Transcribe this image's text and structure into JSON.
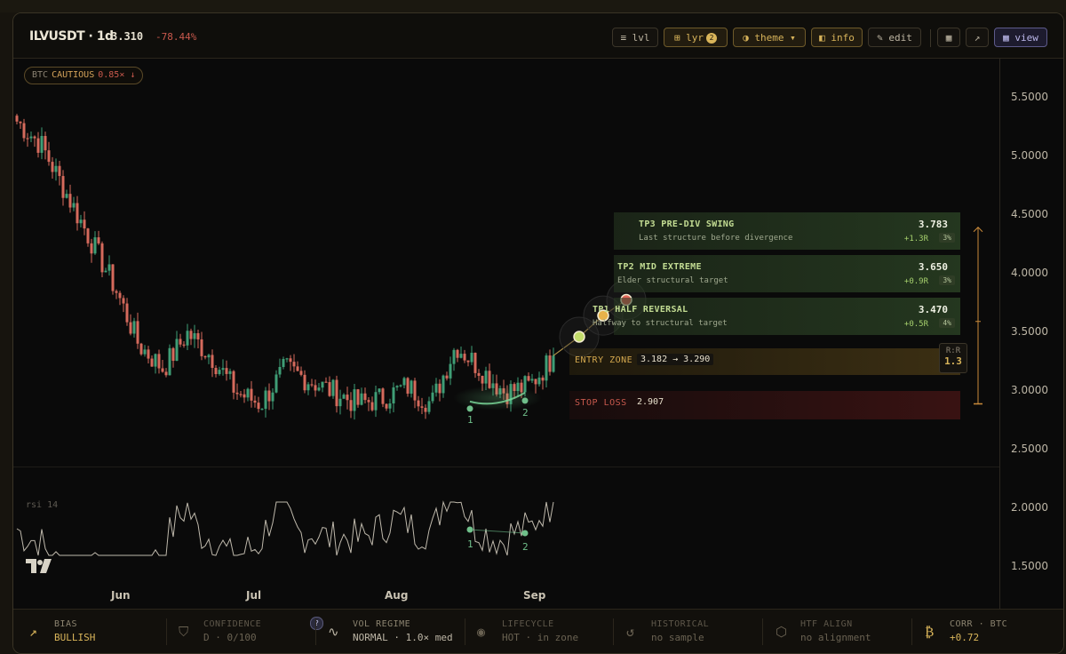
{
  "header": {
    "symbol": "ILVUSDT · 1d",
    "price": "3.310",
    "change": "-78.44%",
    "buttons": {
      "lvl": "≡ lvl",
      "lyr": "⊞ lyr",
      "lyr_badge": "2",
      "theme": "◑ theme ▾",
      "info": "◧ info",
      "edit": "✎ edit",
      "grid": "▦",
      "expand": "↗",
      "view": "▦ view"
    }
  },
  "btc_status": {
    "prefix": "BTC",
    "state": "CAUTIOUS",
    "multiplier": "0.85× ↓"
  },
  "y_axis": [
    "5.5000",
    "5.0000",
    "4.5000",
    "4.0000",
    "3.5000",
    "3.0000",
    "2.5000",
    "2.0000",
    "1.5000"
  ],
  "x_axis": [
    "Jun",
    "Jul",
    "Aug",
    "Sep"
  ],
  "rsi_label": "rsi 14",
  "pivot_labels": [
    "1",
    "2",
    "1",
    "2"
  ],
  "levels": {
    "entry": {
      "label": "ENTRY ZONE",
      "value": "3.182 → 3.290"
    },
    "stop": {
      "label": "STOP LOSS",
      "value": "2.907"
    },
    "targets": [
      {
        "title": "TP3 PRE-DIV SWING",
        "subtitle": "Last structure before divergence",
        "price": "3.783",
        "r": "+1.3R",
        "pct": "3%"
      },
      {
        "title": "TP2 MID EXTREME",
        "subtitle": "Elder structural target",
        "price": "3.650",
        "r": "+0.9R",
        "pct": "3%"
      },
      {
        "title": "TP1 HALF REVERSAL",
        "subtitle": "Halfway to structural target",
        "price": "3.470",
        "r": "+0.5R",
        "pct": "4%"
      }
    ],
    "rr": {
      "label": "R:R",
      "value": "1.3"
    }
  },
  "footer": [
    {
      "label": "BIAS",
      "value": "BULLISH",
      "icon": "trend-up-icon"
    },
    {
      "label": "CONFIDENCE",
      "value": "D · 0/100",
      "icon": "shield-icon"
    },
    {
      "label": "VOL REGIME",
      "value": "NORMAL · 1.0× med",
      "icon": "wave-icon"
    },
    {
      "label": "LIFECYCLE",
      "value": "HOT · in zone",
      "icon": "target-icon"
    },
    {
      "label": "HISTORICAL",
      "value": "no sample",
      "icon": "history-icon"
    },
    {
      "label": "HTF ALIGN",
      "value": "no alignment",
      "icon": "hexagon-icon"
    },
    {
      "label": "CORR · BTC",
      "value": "+0.72",
      "icon": "bitcoin-icon"
    }
  ],
  "help_mark": "?",
  "colors": {
    "bull": "#3f9e76",
    "bear": "#d56a5c",
    "accent": "#d9b55a",
    "tp1": "#c3dc6a",
    "tp2": "#e7b24a",
    "tp3": "#e0675a"
  },
  "chart_data": {
    "type": "candlestick",
    "interval": "1d",
    "y_range": [
      1.5,
      5.5
    ],
    "x_labels": [
      "Jun",
      "Jul",
      "Aug",
      "Sep"
    ],
    "approx_close_trend": [
      5.3,
      5.1,
      4.7,
      4.3,
      3.9,
      3.4,
      3.2,
      3.5,
      3.3,
      3.0,
      2.9,
      3.2,
      3.1,
      3.0,
      2.9,
      2.95,
      3.05,
      2.9,
      3.4,
      3.2,
      3.0,
      3.05,
      3.3
    ],
    "last_price": 3.31
  }
}
